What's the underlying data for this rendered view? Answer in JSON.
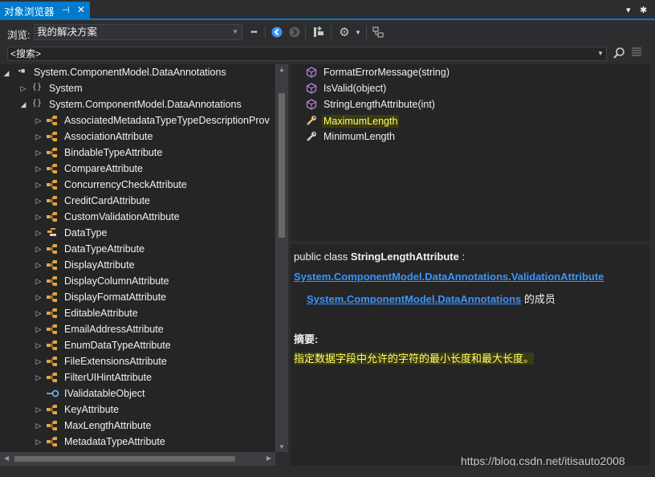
{
  "window": {
    "tab_title": "对象浏览器",
    "pin_glyph": "⊣",
    "close_glyph": "✕",
    "dropdown_glyph": "▾",
    "settings_glyph": "✱"
  },
  "toolbar": {
    "browse_label": "浏览:",
    "browse_value": "我的解决方案",
    "more_glyph": "•••",
    "back_icon": "back-icon",
    "forward_icon": "forward-icon",
    "add_ref_icon": "add-reference-icon",
    "settings_icon": "gear-icon",
    "view_icon": "class-view-icon"
  },
  "search": {
    "value": "<搜索>"
  },
  "tree": {
    "root": {
      "label": "System.ComponentModel.DataAnnotations",
      "expanded": true
    },
    "items": [
      {
        "label": "System",
        "kind": "namespace",
        "expanded": false,
        "level": 1
      },
      {
        "label": "System.ComponentModel.DataAnnotations",
        "kind": "namespace",
        "expanded": true,
        "level": 1
      },
      {
        "label": "AssociatedMetadataTypeTypeDescriptionProv",
        "kind": "class",
        "level": 2
      },
      {
        "label": "AssociationAttribute",
        "kind": "class",
        "level": 2
      },
      {
        "label": "BindableTypeAttribute",
        "kind": "class",
        "level": 2
      },
      {
        "label": "CompareAttribute",
        "kind": "class",
        "level": 2
      },
      {
        "label": "ConcurrencyCheckAttribute",
        "kind": "class",
        "level": 2
      },
      {
        "label": "CreditCardAttribute",
        "kind": "class",
        "level": 2
      },
      {
        "label": "CustomValidationAttribute",
        "kind": "class",
        "level": 2
      },
      {
        "label": "DataType",
        "kind": "enum",
        "level": 2
      },
      {
        "label": "DataTypeAttribute",
        "kind": "class",
        "level": 2
      },
      {
        "label": "DisplayAttribute",
        "kind": "class",
        "level": 2
      },
      {
        "label": "DisplayColumnAttribute",
        "kind": "class",
        "level": 2
      },
      {
        "label": "DisplayFormatAttribute",
        "kind": "class",
        "level": 2
      },
      {
        "label": "EditableAttribute",
        "kind": "class",
        "level": 2
      },
      {
        "label": "EmailAddressAttribute",
        "kind": "class",
        "level": 2
      },
      {
        "label": "EnumDataTypeAttribute",
        "kind": "class",
        "level": 2
      },
      {
        "label": "FileExtensionsAttribute",
        "kind": "class",
        "level": 2
      },
      {
        "label": "FilterUIHintAttribute",
        "kind": "class",
        "level": 2
      },
      {
        "label": "IValidatableObject",
        "kind": "interface",
        "level": 2
      },
      {
        "label": "KeyAttribute",
        "kind": "class",
        "level": 2
      },
      {
        "label": "MaxLengthAttribute",
        "kind": "class",
        "level": 2
      },
      {
        "label": "MetadataTypeAttribute",
        "kind": "class",
        "level": 2
      }
    ]
  },
  "members": [
    {
      "label": "FormatErrorMessage(string)",
      "kind": "method"
    },
    {
      "label": "IsValid(object)",
      "kind": "method"
    },
    {
      "label": "StringLengthAttribute(int)",
      "kind": "method"
    },
    {
      "label": "MaximumLength",
      "kind": "property",
      "highlighted": true
    },
    {
      "label": "MinimumLength",
      "kind": "property"
    }
  ],
  "description": {
    "decl_prefix": "public class ",
    "decl_name": "StringLengthAttribute",
    "decl_suffix": " :",
    "base_link": "System.ComponentModel.DataAnnotations.ValidationAttribute",
    "namespace_link": "System.ComponentModel.DataAnnotations",
    "member_of": " 的成员",
    "summary_heading": "摘要:",
    "summary_text": "指定数据字段中允许的字符的最小长度和最大长度。"
  },
  "watermark": "https://blog.csdn.net/itisauto2008",
  "colors": {
    "accent": "#007acc",
    "link": "#3794ff",
    "highlight_text": "#ffff66",
    "class_icon": "#e8a33d",
    "method_icon": "#b180d7",
    "interface_icon": "#75beff"
  }
}
